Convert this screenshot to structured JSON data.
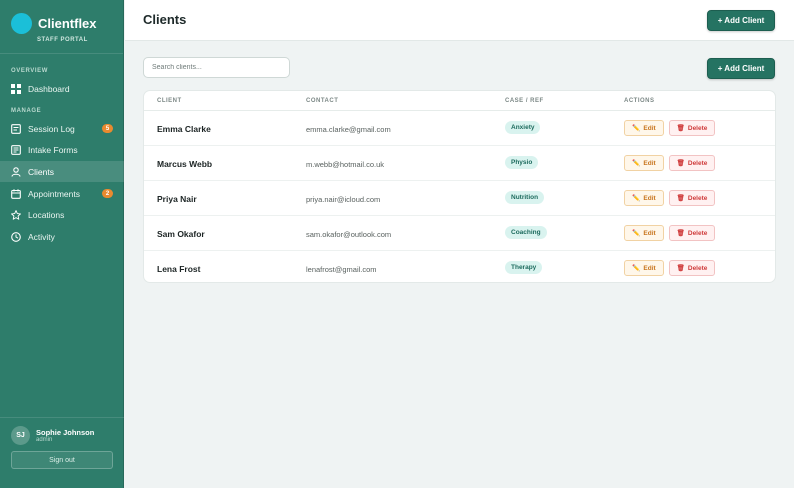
{
  "sidebar": {
    "brand": "Clientflex",
    "subtitle": "STAFF PORTAL",
    "sections": {
      "overview": "OVERVIEW",
      "manage": "MANAGE"
    },
    "items": [
      {
        "label": "Dashboard",
        "icon": "dashboard-icon"
      },
      {
        "label": "Session Log",
        "icon": "session-log-icon",
        "badge": "5"
      },
      {
        "label": "Intake Forms",
        "icon": "intake-forms-icon"
      },
      {
        "label": "Clients",
        "icon": "user-icon",
        "active": true
      },
      {
        "label": "Appointments",
        "icon": "calendar-icon",
        "badge": "2"
      },
      {
        "label": "Locations",
        "icon": "star-icon"
      },
      {
        "label": "Activity",
        "icon": "clock-icon"
      }
    ],
    "user": {
      "initials": "SJ",
      "name": "Sophie Johnson",
      "role": "admin",
      "signout": "Sign out"
    }
  },
  "header": {
    "title": "Clients",
    "add_label": "+ Add Client"
  },
  "main": {
    "search_placeholder": "Search clients...",
    "add_label": "+ Add Client",
    "columns": [
      "CLIENT",
      "CONTACT",
      "CASE / REF",
      "ACTIONS"
    ],
    "edit_label": "Edit",
    "delete_label": "Delete",
    "rows": [
      {
        "name": "Emma Clarke",
        "contact": "emma.clarke@gmail.com",
        "tag": "Anxiety"
      },
      {
        "name": "Marcus Webb",
        "contact": "m.webb@hotmail.co.uk",
        "tag": "Physio"
      },
      {
        "name": "Priya Nair",
        "contact": "priya.nair@icloud.com",
        "tag": "Nutrition"
      },
      {
        "name": "Sam Okafor",
        "contact": "sam.okafor@outlook.com",
        "tag": "Coaching"
      },
      {
        "name": "Lena Frost",
        "contact": "lenafrost@gmail.com",
        "tag": "Therapy"
      }
    ]
  },
  "colors": {
    "sidebar": "#2e7d6b",
    "accent": "#257362",
    "logo": "#1bbfd8",
    "badge": "#e98a2f"
  }
}
